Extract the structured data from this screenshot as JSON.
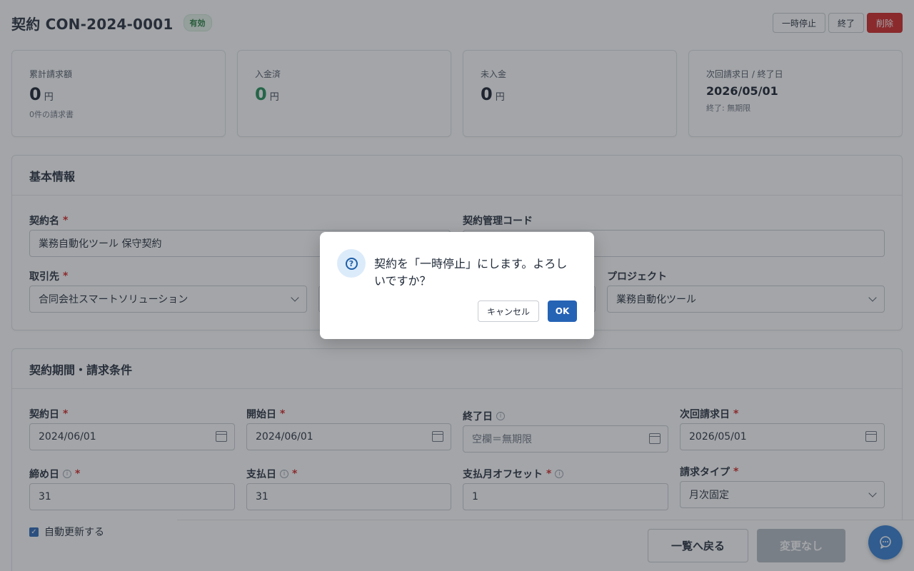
{
  "header": {
    "title": "契約 CON-2024-0001",
    "status": "有効",
    "actions": {
      "pause": "一時停止",
      "end": "終了",
      "delete": "削除"
    }
  },
  "summary": {
    "billed": {
      "label": "累計請求額",
      "value": "0",
      "unit": "円",
      "sub": "0件の請求書"
    },
    "paid": {
      "label": "入金済",
      "value": "0",
      "unit": "円"
    },
    "unpaid": {
      "label": "未入金",
      "value": "0",
      "unit": "円"
    },
    "next": {
      "label": "次回請求日 / 終了日",
      "date": "2026/05/01",
      "sub": "終了: 無期限"
    }
  },
  "basic": {
    "heading": "基本情報",
    "contract_name": {
      "label": "契約名",
      "value": "業務自動化ツール 保守契約"
    },
    "management_code": {
      "label": "契約管理コード"
    },
    "client": {
      "label": "取引先",
      "value": "合同会社スマートソリューション"
    },
    "project": {
      "label": "プロジェクト",
      "value": "業務自動化ツール"
    }
  },
  "terms": {
    "heading": "契約期間・請求条件",
    "contract_date": {
      "label": "契約日",
      "value": "2024/06/01"
    },
    "start_date": {
      "label": "開始日",
      "value": "2024/06/01"
    },
    "end_date": {
      "label": "終了日",
      "placeholder": "空欄＝無期限"
    },
    "next_billing": {
      "label": "次回請求日",
      "value": "2026/05/01"
    },
    "closing_day": {
      "label": "締め日",
      "value": "31"
    },
    "payment_day": {
      "label": "支払日",
      "value": "31"
    },
    "payment_month_offset": {
      "label": "支払月オフセット",
      "value": "1"
    },
    "billing_type": {
      "label": "請求タイプ",
      "value": "月次固定"
    },
    "auto_renew": {
      "label": "自動更新する",
      "checked": true
    }
  },
  "footer": {
    "back": "一覧へ戻る",
    "save": "変更なし"
  },
  "dialog": {
    "message": "契約を「一時停止」にします。よろしいですか？",
    "cancel": "キャンセル",
    "ok": "OK"
  },
  "icons": {
    "dialog": "question-circle-icon",
    "fab": "chat-bubble-icon"
  },
  "colors": {
    "accent": "#2563b5",
    "danger": "#d42020",
    "success": "#1a8a53"
  }
}
